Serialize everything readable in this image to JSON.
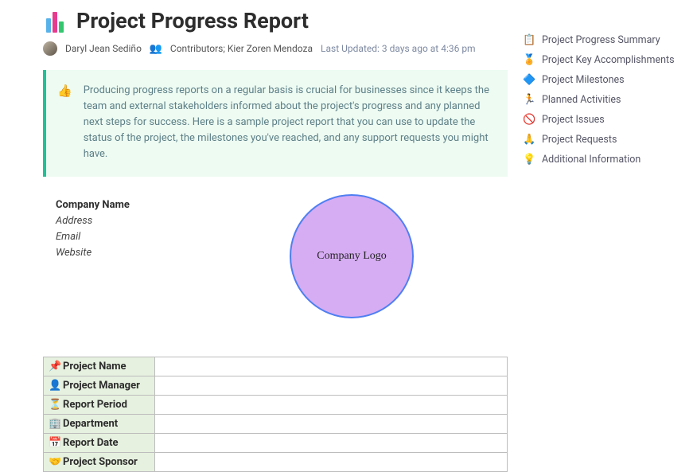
{
  "title": "Project Progress Report",
  "author": "Daryl Jean Sediño",
  "contributors_label": "Contributors;",
  "contributors_value": "Kier Zoren Mendoza",
  "last_updated_label": "Last Updated:",
  "last_updated_value": "3 days ago at 4:36 pm",
  "callout_text": "Producing progress reports on a regular basis is crucial for businesses since it keeps the team and external stakeholders informed about the project's progress and any planned next steps for success. Here is a sample project report that you can use to update the status of the project, the milestones you've reached, and any support requests you might have.",
  "company": {
    "name": "Company Name",
    "address": "Address",
    "email": "Email",
    "website": "Website",
    "logo_text": "Company Logo"
  },
  "table_rows": [
    {
      "icon": "📌",
      "label": "Project Name"
    },
    {
      "icon": "👤",
      "label": "Project Manager"
    },
    {
      "icon": "⏳",
      "label": "Report Period"
    },
    {
      "icon": "🏢",
      "label": "Department"
    },
    {
      "icon": "📅",
      "label": "Report Date"
    },
    {
      "icon": "🤝",
      "label": "Project Sponsor"
    }
  ],
  "nav": [
    {
      "icon": "📋",
      "label": "Project Progress Summary"
    },
    {
      "icon": "🏅",
      "label": "Project Key Accomplishments"
    },
    {
      "icon": "🔷",
      "label": "Project Milestones"
    },
    {
      "icon": "🏃",
      "label": "Planned Activities"
    },
    {
      "icon": "🚫",
      "label": "Project Issues"
    },
    {
      "icon": "🙏",
      "label": "Project Requests"
    },
    {
      "icon": "💡",
      "label": "Additional Information"
    }
  ]
}
